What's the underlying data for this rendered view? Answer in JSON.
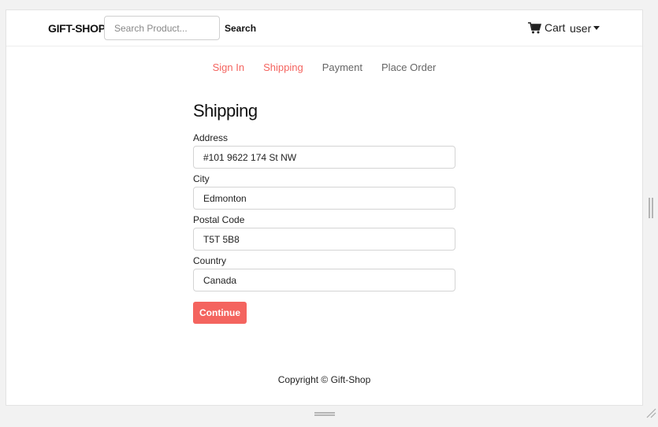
{
  "navbar": {
    "brand": "GIFT-SHOP",
    "search_placeholder": "Search Product...",
    "search_label": "Search",
    "cart_icon": "cart-icon",
    "cart_label": "Cart",
    "user_label": "user"
  },
  "steps": [
    {
      "label": "Sign In",
      "state": "active"
    },
    {
      "label": "Shipping",
      "state": "active"
    },
    {
      "label": "Payment",
      "state": "inactive"
    },
    {
      "label": "Place Order",
      "state": "inactive"
    }
  ],
  "form": {
    "title": "Shipping",
    "address_label": "Address",
    "address_value": "#101 9622 174 St NW",
    "city_label": "City",
    "city_value": "Edmonton",
    "postal_label": "Postal Code",
    "postal_value": "T5T 5B8",
    "country_label": "Country",
    "country_value": "Canada",
    "continue_label": "Continue"
  },
  "footer": {
    "copyright": "Copyright © Gift-Shop"
  },
  "colors": {
    "accent": "#f4645f",
    "inactive_step": "#666666"
  }
}
